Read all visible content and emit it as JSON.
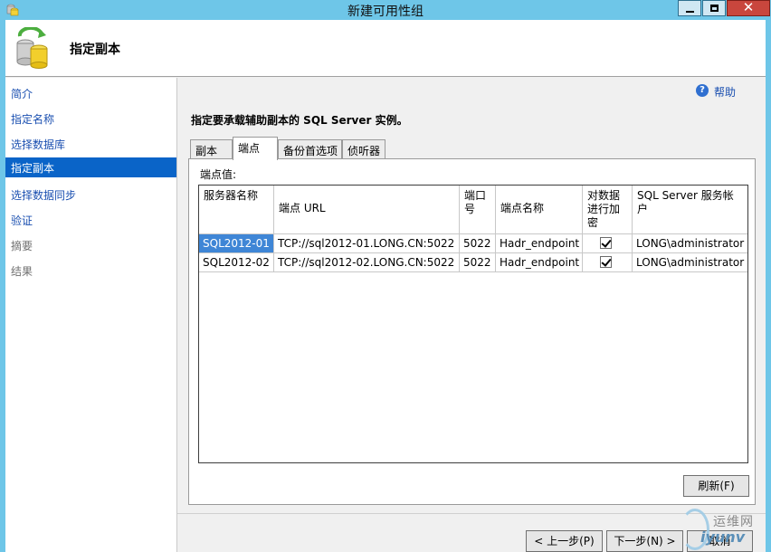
{
  "window": {
    "title": "新建可用性组",
    "close_glyph": "✕"
  },
  "header": {
    "title": "指定副本"
  },
  "sidebar": {
    "items": [
      {
        "label": "简介",
        "state": "link"
      },
      {
        "label": "指定名称",
        "state": "link"
      },
      {
        "label": "选择数据库",
        "state": "link"
      },
      {
        "label": "指定副本",
        "state": "active"
      },
      {
        "label": "选择数据同步",
        "state": "link"
      },
      {
        "label": "验证",
        "state": "link"
      },
      {
        "label": "摘要",
        "state": "disabled"
      },
      {
        "label": "结果",
        "state": "disabled"
      }
    ]
  },
  "help": {
    "label": "帮助",
    "icon": "?"
  },
  "main": {
    "instruction": "指定要承载辅助副本的 SQL Server 实例。",
    "tabs": [
      {
        "label": "副本"
      },
      {
        "label": "端点"
      },
      {
        "label": "备份首选项"
      },
      {
        "label": "侦听器"
      }
    ],
    "active_tab": "端点",
    "panel_caption": "端点值:",
    "table": {
      "headers": [
        "服务器名称",
        "端点 URL",
        "端口号",
        "端点名称",
        "对数据进行加密",
        "SQL Server 服务帐户"
      ],
      "rows": [
        {
          "server": "SQL2012-01",
          "url": "TCP://sql2012-01.LONG.CN:5022",
          "port": "5022",
          "endpoint": "Hadr_endpoint",
          "encrypt": true,
          "account": "LONG\\administrator"
        },
        {
          "server": "SQL2012-02",
          "url": "TCP://sql2012-02.LONG.CN:5022",
          "port": "5022",
          "endpoint": "Hadr_endpoint",
          "encrypt": true,
          "account": "LONG\\administrator"
        }
      ]
    },
    "refresh_label": "刷新(F)"
  },
  "footer": {
    "prev_label": "< 上一步(P)",
    "next_label": "下一步(N) >",
    "cancel_label": "取消"
  },
  "watermark": {
    "top": "运维网",
    "bottom": "iyunv"
  }
}
